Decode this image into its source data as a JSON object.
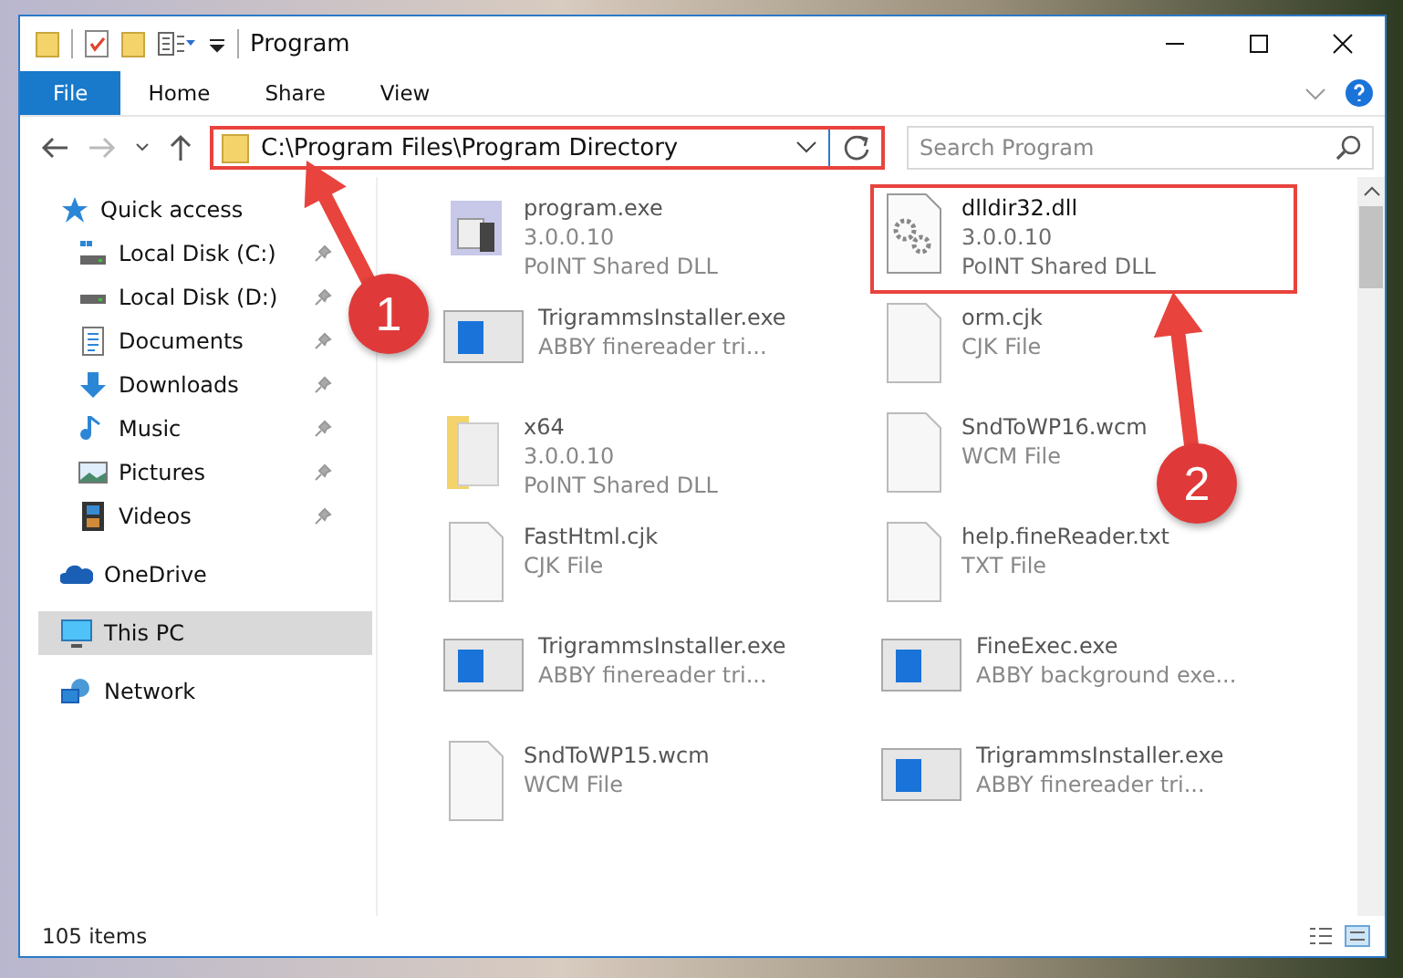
{
  "window": {
    "title": "Program"
  },
  "ribbon": {
    "tabs": [
      {
        "label": "File",
        "kind": "menu"
      },
      {
        "label": "Home",
        "kind": "tab"
      },
      {
        "label": "Share",
        "kind": "tab"
      },
      {
        "label": "View",
        "kind": "tab"
      }
    ]
  },
  "address_bar": {
    "path": "C:\\Program Files\\Program Directory",
    "highlighted": true
  },
  "search": {
    "placeholder": "Search Program"
  },
  "sidebar": {
    "items": [
      {
        "label": "Quick access",
        "selected": false,
        "children": [
          {
            "label": "Local Disk (C:)",
            "pinned": true,
            "selected": false
          },
          {
            "label": "Local Disk (D:)",
            "pinned": true,
            "selected": false
          },
          {
            "label": "Documents",
            "pinned": true,
            "selected": false
          },
          {
            "label": "Downloads",
            "pinned": true,
            "selected": false
          },
          {
            "label": "Music",
            "pinned": true,
            "selected": false
          },
          {
            "label": "Pictures",
            "pinned": true,
            "selected": false
          },
          {
            "label": "Videos",
            "pinned": true,
            "selected": false
          }
        ]
      },
      {
        "label": "OneDrive",
        "selected": false
      },
      {
        "label": "This PC",
        "selected": true
      },
      {
        "label": "Network",
        "selected": false
      }
    ]
  },
  "files": [
    {
      "name": "program.exe",
      "details": [
        "3.0.0.10",
        "PoINT Shared DLL"
      ],
      "highlighted": false
    },
    {
      "name": "dlldir32.dll",
      "details": [
        "3.0.0.10",
        "PoINT Shared DLL"
      ],
      "highlighted": true
    },
    {
      "name": "TrigrammsInstaller.exe",
      "details": [
        "ABBY finereader tri..."
      ],
      "highlighted": false
    },
    {
      "name": "orm.cjk",
      "details": [
        "CJK File"
      ],
      "highlighted": false
    },
    {
      "name": "x64",
      "details": [
        "3.0.0.10",
        "PoINT Shared DLL"
      ],
      "highlighted": false
    },
    {
      "name": "SndToWP16.wcm",
      "details": [
        "WCM File"
      ],
      "highlighted": false
    },
    {
      "name": "FastHtml.cjk",
      "details": [
        "CJK File"
      ],
      "highlighted": false
    },
    {
      "name": "help.fineReader.txt",
      "details": [
        "TXT File"
      ],
      "highlighted": false
    },
    {
      "name": "TrigrammsInstaller.exe",
      "details": [
        "ABBY finereader tri..."
      ],
      "highlighted": false
    },
    {
      "name": "FineExec.exe",
      "details": [
        "ABBY background exe..."
      ],
      "highlighted": false
    },
    {
      "name": "SndToWP15.wcm",
      "details": [
        "WCM File"
      ],
      "highlighted": false
    },
    {
      "name": "TrigrammsInstaller.exe",
      "details": [
        "ABBY finereader tri..."
      ],
      "highlighted": false
    }
  ],
  "status_bar": {
    "count": "105 items"
  },
  "callouts": [
    {
      "number": "1"
    },
    {
      "number": "2"
    }
  ]
}
